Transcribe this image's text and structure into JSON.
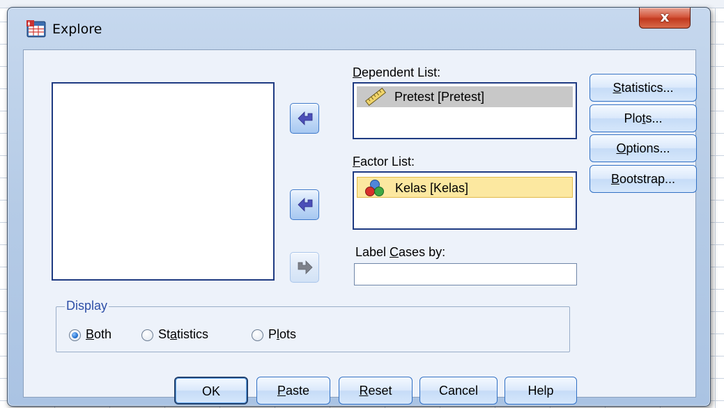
{
  "window": {
    "title": "Explore",
    "close_glyph": "x",
    "icon": "explore-table-icon"
  },
  "dependent_list": {
    "label": {
      "before": "",
      "mnemonic": "D",
      "after": "ependent List:"
    },
    "items": [
      {
        "text": "Pretest [Pretest]",
        "icon": "scale-ruler-icon",
        "highlight": "grey"
      }
    ]
  },
  "factor_list": {
    "label": {
      "before": "",
      "mnemonic": "F",
      "after": "actor List:"
    },
    "items": [
      {
        "text": "Kelas [Kelas]",
        "icon": "nominal-balls-icon",
        "highlight": "yellow"
      }
    ]
  },
  "label_cases": {
    "label": {
      "before": "Label ",
      "mnemonic": "C",
      "after": "ases by:"
    },
    "value": ""
  },
  "side_buttons": [
    {
      "before": "",
      "mnemonic": "S",
      "after": "tatistics..."
    },
    {
      "before": "Plo",
      "mnemonic": "t",
      "after": "s..."
    },
    {
      "before": "",
      "mnemonic": "O",
      "after": "ptions..."
    },
    {
      "before": "",
      "mnemonic": "B",
      "after": "ootstrap..."
    }
  ],
  "display": {
    "legend": "Display",
    "options": [
      {
        "before": "",
        "mnemonic": "B",
        "after": "oth",
        "checked": true
      },
      {
        "before": "St",
        "mnemonic": "a",
        "after": "tistics",
        "checked": false
      },
      {
        "before": "P",
        "mnemonic": "l",
        "after": "ots",
        "checked": false
      }
    ]
  },
  "bottom_buttons": [
    {
      "before": "OK",
      "mnemonic": "",
      "after": ""
    },
    {
      "before": "",
      "mnemonic": "P",
      "after": "aste"
    },
    {
      "before": "",
      "mnemonic": "R",
      "after": "eset"
    },
    {
      "before": "Cancel",
      "mnemonic": "",
      "after": ""
    },
    {
      "before": "Help",
      "mnemonic": "",
      "after": ""
    }
  ],
  "colors": {
    "list_border": "#1f3b82",
    "selection_grey": "#c8c8c8",
    "selection_yellow": "#fce8a0",
    "close_red": "#c23a1f",
    "legend_blue": "#2e4fa7"
  }
}
